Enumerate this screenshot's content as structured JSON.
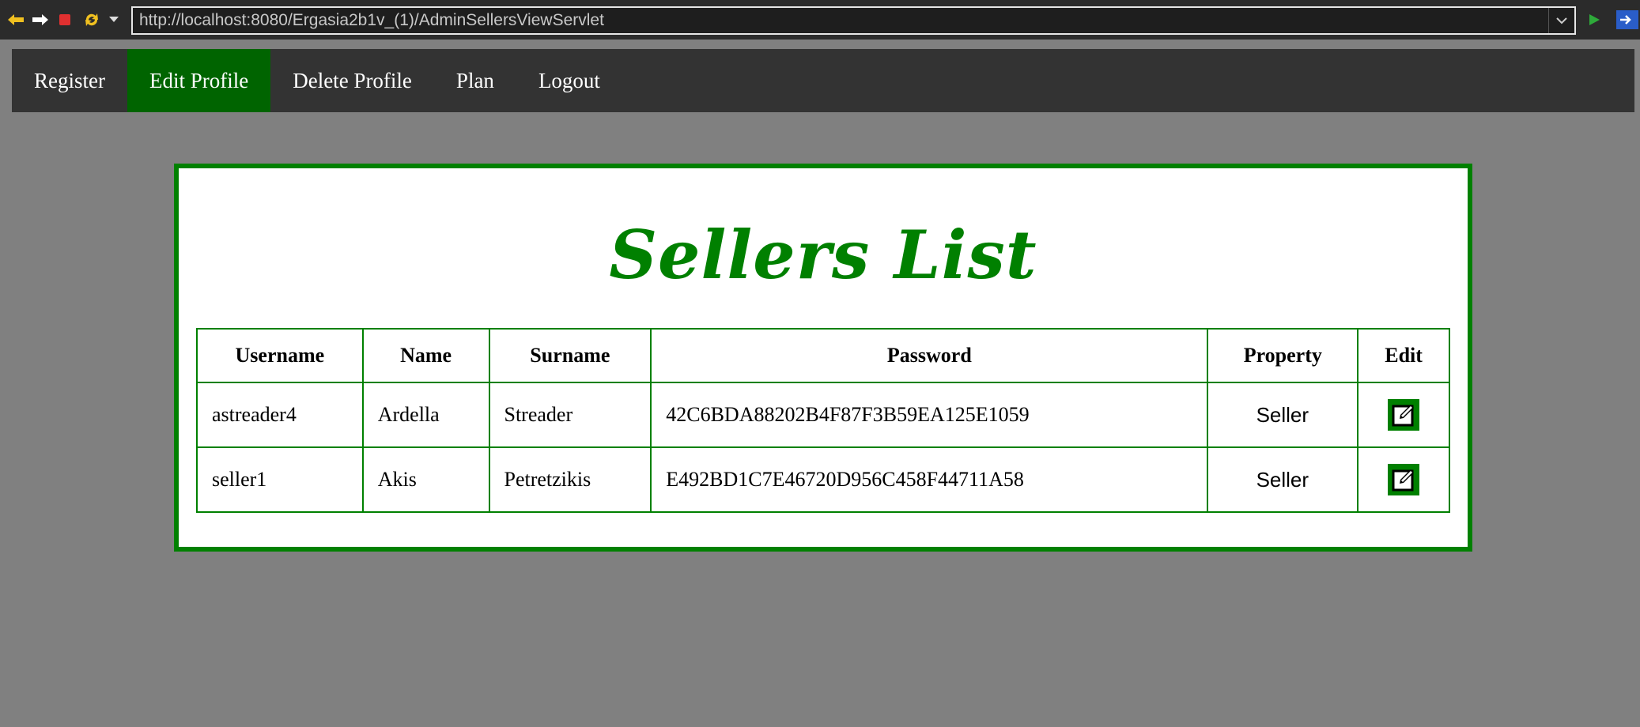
{
  "browser": {
    "url": "http://localhost:8080/Ergasia2b1v_(1)/AdminSellersViewServlet"
  },
  "nav": {
    "items": [
      {
        "label": "Register"
      },
      {
        "label": "Edit Profile"
      },
      {
        "label": "Delete Profile"
      },
      {
        "label": "Plan"
      },
      {
        "label": "Logout"
      }
    ],
    "active_color": "#006400"
  },
  "main": {
    "title": "Sellers List",
    "table": {
      "headers": [
        "Username",
        "Name",
        "Surname",
        "Password",
        "Property",
        "Edit"
      ],
      "rows": [
        {
          "username": "astreader4",
          "name": "Ardella",
          "surname": "Streader",
          "password": "42C6BDA88202B4F87F3B59EA125E1059",
          "property": "Seller",
          "edit_icon": "edit-icon"
        },
        {
          "username": "seller1",
          "name": "Akis",
          "surname": "Petretzikis",
          "password": "E492BD1C7E46720D956C458F44711A58",
          "property": "Seller",
          "edit_icon": "edit-icon"
        }
      ]
    }
  },
  "colors": {
    "accent_green": "#008000",
    "background": "#808080",
    "navbar": "#333333"
  }
}
